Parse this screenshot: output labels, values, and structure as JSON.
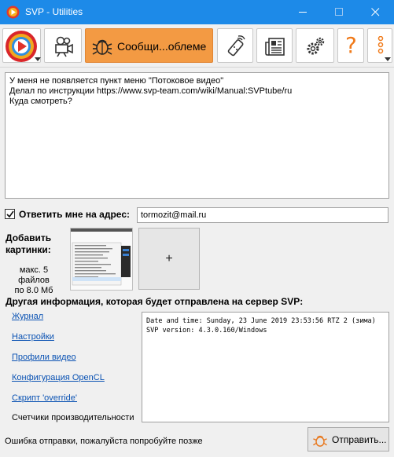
{
  "window": {
    "title": "SVP - Utilities",
    "accent": "#1d8ae8"
  },
  "toolbar": {
    "active_color": "#f39a43",
    "items": [
      {
        "icon": "svp-logo-icon"
      },
      {
        "icon": "camera-icon"
      },
      {
        "icon": "bug-icon",
        "label": "Сообщи...облеме"
      },
      {
        "icon": "remote-control-icon"
      },
      {
        "icon": "newspaper-icon"
      },
      {
        "icon": "gears-icon"
      },
      {
        "icon": "help-icon",
        "label": "?"
      },
      {
        "icon": "more-icon"
      }
    ]
  },
  "message": {
    "lines": [
      "У меня не появляется пункт меню \"Потоковое видео\"",
      "Делал по инструкции https://www.svp-team.com/wiki/Manual:SVPtube/ru",
      "Куда смотреть?"
    ]
  },
  "reply": {
    "checked": true,
    "label": "Ответить мне на адрес:",
    "email": "tormozit@mail.ru"
  },
  "attachments": {
    "title_line1": "Добавить",
    "title_line2": "картинки:",
    "limit_line1": "макс. 5 файлов",
    "limit_line2": "по 8.0 Мб",
    "add_label": "+"
  },
  "other_info": {
    "heading": "Другая информация, которая будет отправлена на сервер SVP:",
    "links": [
      "Журнал",
      "Настройки",
      "Профили видео",
      "Конфигурация OpenCL",
      "Скрипт 'override'"
    ],
    "perf_label": "Счетчики производительности",
    "info_lines": [
      "Date and time: Sunday, 23 June 2019 23:53:56 RTZ 2 (зима)",
      "SVP version: 4.3.0.160/Windows"
    ]
  },
  "footer": {
    "status": "Ошибка отправки, пожалуйста попробуйте позже",
    "send_label": "Отправить..."
  }
}
